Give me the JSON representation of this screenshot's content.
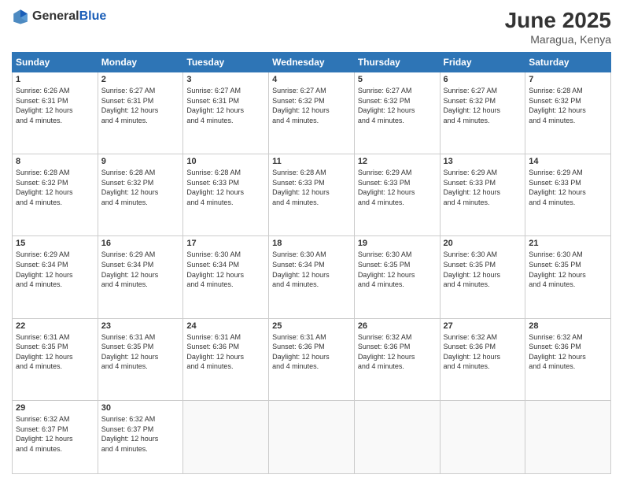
{
  "header": {
    "logo_general": "General",
    "logo_blue": "Blue",
    "month_year": "June 2025",
    "location": "Maragua, Kenya"
  },
  "weekdays": [
    "Sunday",
    "Monday",
    "Tuesday",
    "Wednesday",
    "Thursday",
    "Friday",
    "Saturday"
  ],
  "weeks": [
    [
      {
        "day": "1",
        "sunrise": "6:26 AM",
        "sunset": "6:31 PM",
        "daylight": "12 hours and 4 minutes."
      },
      {
        "day": "2",
        "sunrise": "6:27 AM",
        "sunset": "6:31 PM",
        "daylight": "12 hours and 4 minutes."
      },
      {
        "day": "3",
        "sunrise": "6:27 AM",
        "sunset": "6:31 PM",
        "daylight": "12 hours and 4 minutes."
      },
      {
        "day": "4",
        "sunrise": "6:27 AM",
        "sunset": "6:32 PM",
        "daylight": "12 hours and 4 minutes."
      },
      {
        "day": "5",
        "sunrise": "6:27 AM",
        "sunset": "6:32 PM",
        "daylight": "12 hours and 4 minutes."
      },
      {
        "day": "6",
        "sunrise": "6:27 AM",
        "sunset": "6:32 PM",
        "daylight": "12 hours and 4 minutes."
      },
      {
        "day": "7",
        "sunrise": "6:28 AM",
        "sunset": "6:32 PM",
        "daylight": "12 hours and 4 minutes."
      }
    ],
    [
      {
        "day": "8",
        "sunrise": "6:28 AM",
        "sunset": "6:32 PM",
        "daylight": "12 hours and 4 minutes."
      },
      {
        "day": "9",
        "sunrise": "6:28 AM",
        "sunset": "6:32 PM",
        "daylight": "12 hours and 4 minutes."
      },
      {
        "day": "10",
        "sunrise": "6:28 AM",
        "sunset": "6:33 PM",
        "daylight": "12 hours and 4 minutes."
      },
      {
        "day": "11",
        "sunrise": "6:28 AM",
        "sunset": "6:33 PM",
        "daylight": "12 hours and 4 minutes."
      },
      {
        "day": "12",
        "sunrise": "6:29 AM",
        "sunset": "6:33 PM",
        "daylight": "12 hours and 4 minutes."
      },
      {
        "day": "13",
        "sunrise": "6:29 AM",
        "sunset": "6:33 PM",
        "daylight": "12 hours and 4 minutes."
      },
      {
        "day": "14",
        "sunrise": "6:29 AM",
        "sunset": "6:33 PM",
        "daylight": "12 hours and 4 minutes."
      }
    ],
    [
      {
        "day": "15",
        "sunrise": "6:29 AM",
        "sunset": "6:34 PM",
        "daylight": "12 hours and 4 minutes."
      },
      {
        "day": "16",
        "sunrise": "6:29 AM",
        "sunset": "6:34 PM",
        "daylight": "12 hours and 4 minutes."
      },
      {
        "day": "17",
        "sunrise": "6:30 AM",
        "sunset": "6:34 PM",
        "daylight": "12 hours and 4 minutes."
      },
      {
        "day": "18",
        "sunrise": "6:30 AM",
        "sunset": "6:34 PM",
        "daylight": "12 hours and 4 minutes."
      },
      {
        "day": "19",
        "sunrise": "6:30 AM",
        "sunset": "6:35 PM",
        "daylight": "12 hours and 4 minutes."
      },
      {
        "day": "20",
        "sunrise": "6:30 AM",
        "sunset": "6:35 PM",
        "daylight": "12 hours and 4 minutes."
      },
      {
        "day": "21",
        "sunrise": "6:30 AM",
        "sunset": "6:35 PM",
        "daylight": "12 hours and 4 minutes."
      }
    ],
    [
      {
        "day": "22",
        "sunrise": "6:31 AM",
        "sunset": "6:35 PM",
        "daylight": "12 hours and 4 minutes."
      },
      {
        "day": "23",
        "sunrise": "6:31 AM",
        "sunset": "6:35 PM",
        "daylight": "12 hours and 4 minutes."
      },
      {
        "day": "24",
        "sunrise": "6:31 AM",
        "sunset": "6:36 PM",
        "daylight": "12 hours and 4 minutes."
      },
      {
        "day": "25",
        "sunrise": "6:31 AM",
        "sunset": "6:36 PM",
        "daylight": "12 hours and 4 minutes."
      },
      {
        "day": "26",
        "sunrise": "6:32 AM",
        "sunset": "6:36 PM",
        "daylight": "12 hours and 4 minutes."
      },
      {
        "day": "27",
        "sunrise": "6:32 AM",
        "sunset": "6:36 PM",
        "daylight": "12 hours and 4 minutes."
      },
      {
        "day": "28",
        "sunrise": "6:32 AM",
        "sunset": "6:36 PM",
        "daylight": "12 hours and 4 minutes."
      }
    ],
    [
      {
        "day": "29",
        "sunrise": "6:32 AM",
        "sunset": "6:37 PM",
        "daylight": "12 hours and 4 minutes."
      },
      {
        "day": "30",
        "sunrise": "6:32 AM",
        "sunset": "6:37 PM",
        "daylight": "12 hours and 4 minutes."
      },
      null,
      null,
      null,
      null,
      null
    ]
  ],
  "labels": {
    "sunrise": "Sunrise:",
    "sunset": "Sunset:",
    "daylight": "Daylight:"
  }
}
